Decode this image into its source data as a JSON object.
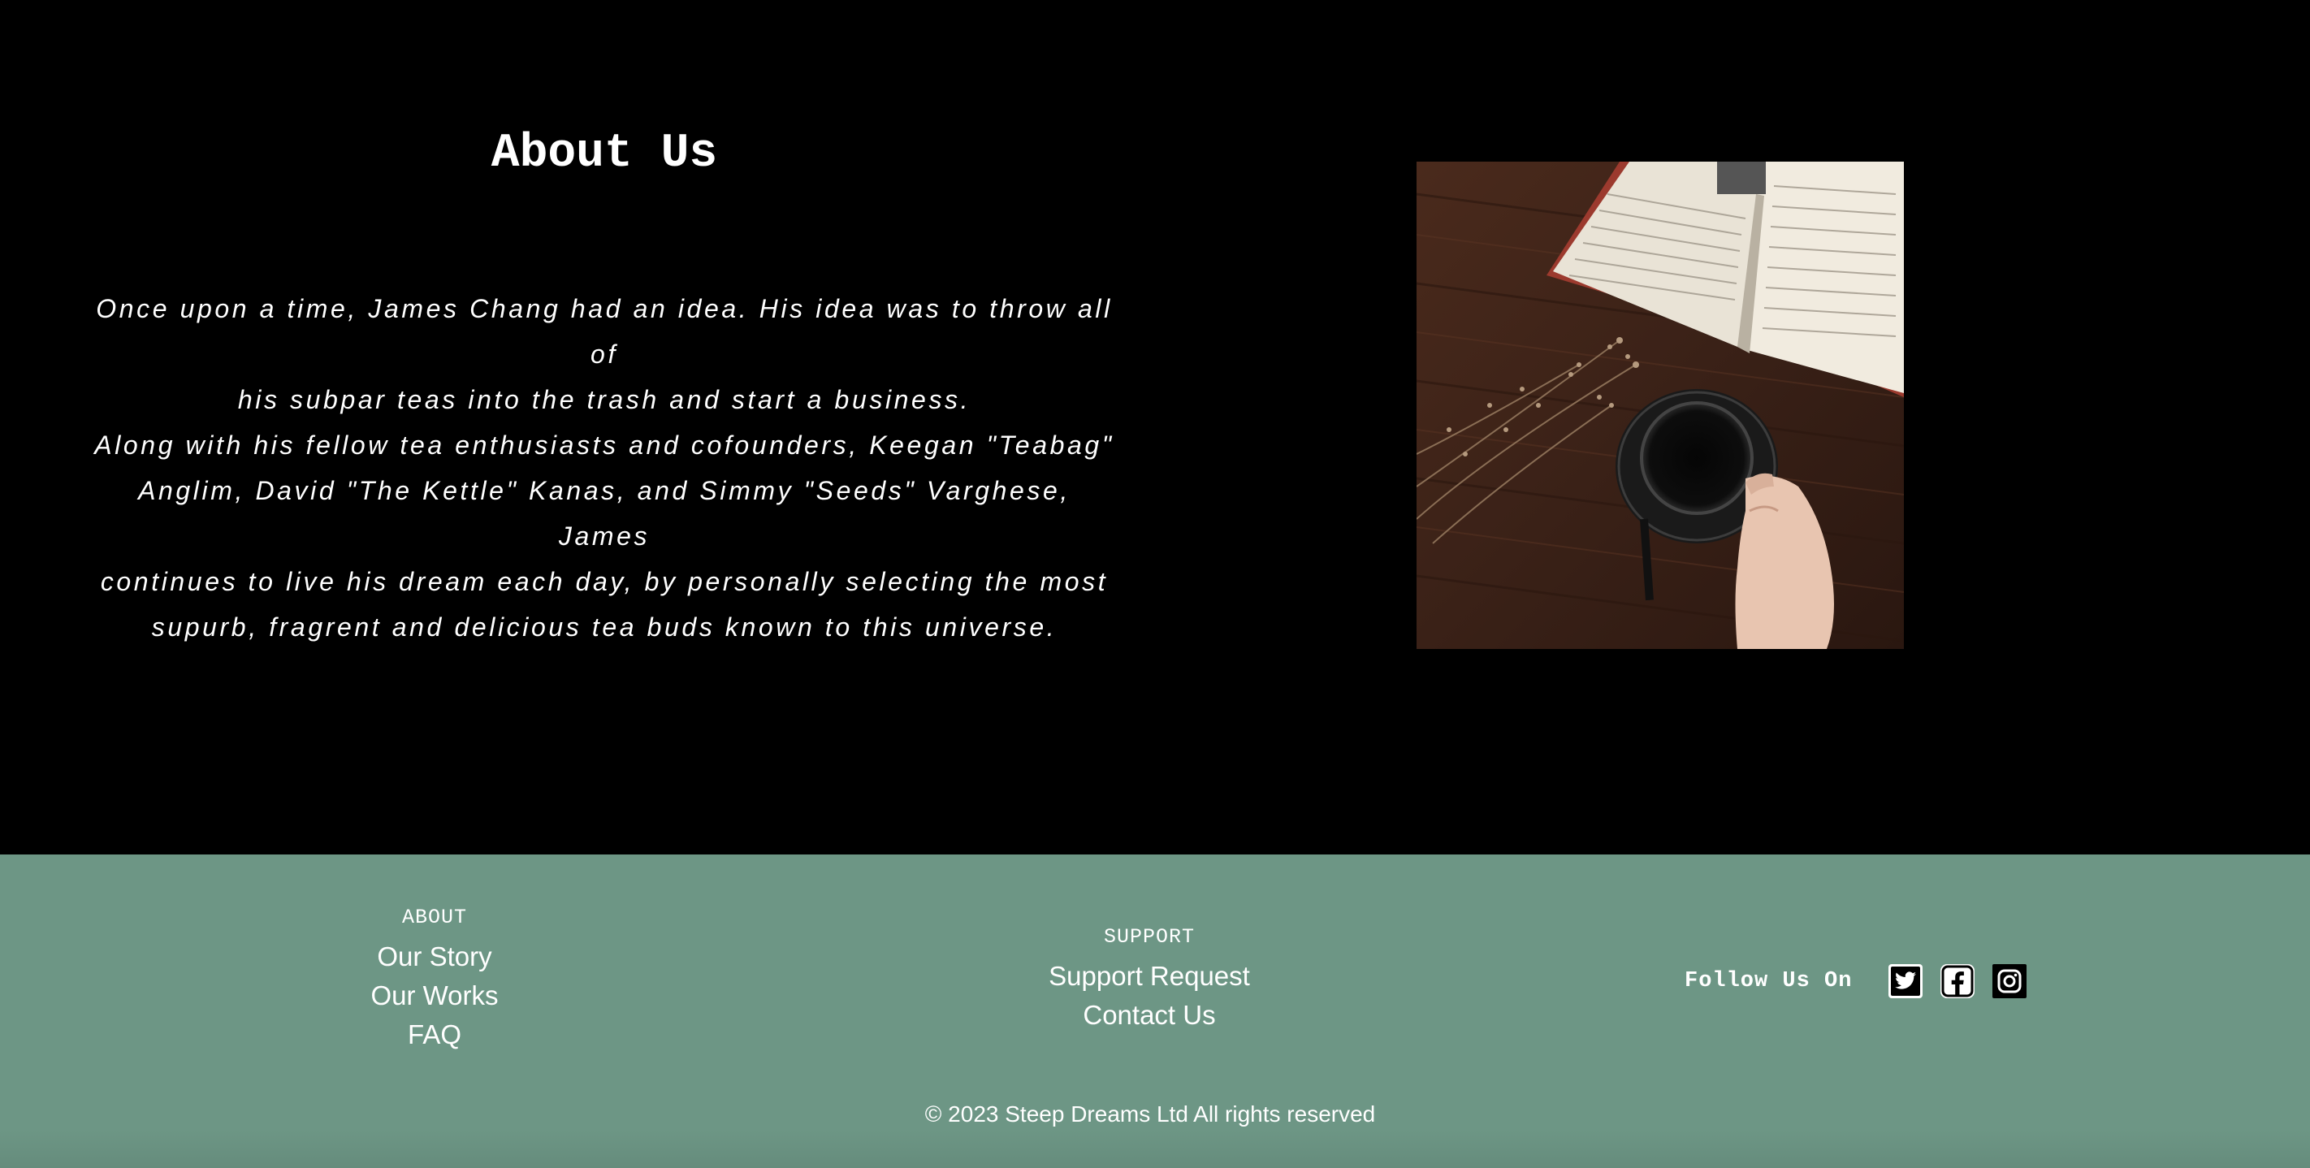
{
  "about": {
    "title": "About Us",
    "paragraph_lines": [
      "Once upon a time, James Chang had an idea. His idea was to throw all of",
      "his subpar teas into the trash and start a business.",
      "Along with his fellow tea enthusiasts and cofounders, Keegan \"Teabag\"",
      "Anglim, David \"The Kettle\" Kanas, and Simmy \"Seeds\" Varghese, James",
      "continues to live his dream each day, by personally selecting the most",
      "supurb, fragrent and delicious tea buds known to this universe."
    ],
    "photo_icon": "tea-cup-and-open-book-photo"
  },
  "footer": {
    "about_col": {
      "heading": "ABOUT",
      "links": [
        "Our Story",
        "Our Works",
        "FAQ"
      ]
    },
    "support_col": {
      "heading": "SUPPORT",
      "links": [
        "Support Request",
        "Contact Us"
      ]
    },
    "follow": {
      "label": "Follow Us On",
      "icons": [
        "twitter-icon",
        "facebook-icon",
        "instagram-icon"
      ]
    },
    "copyright": "© 2023 Steep Dreams Ltd All rights reserved"
  },
  "colors": {
    "page_background": "#000000",
    "footer_background": "#6d9685",
    "text": "#ffffff"
  }
}
